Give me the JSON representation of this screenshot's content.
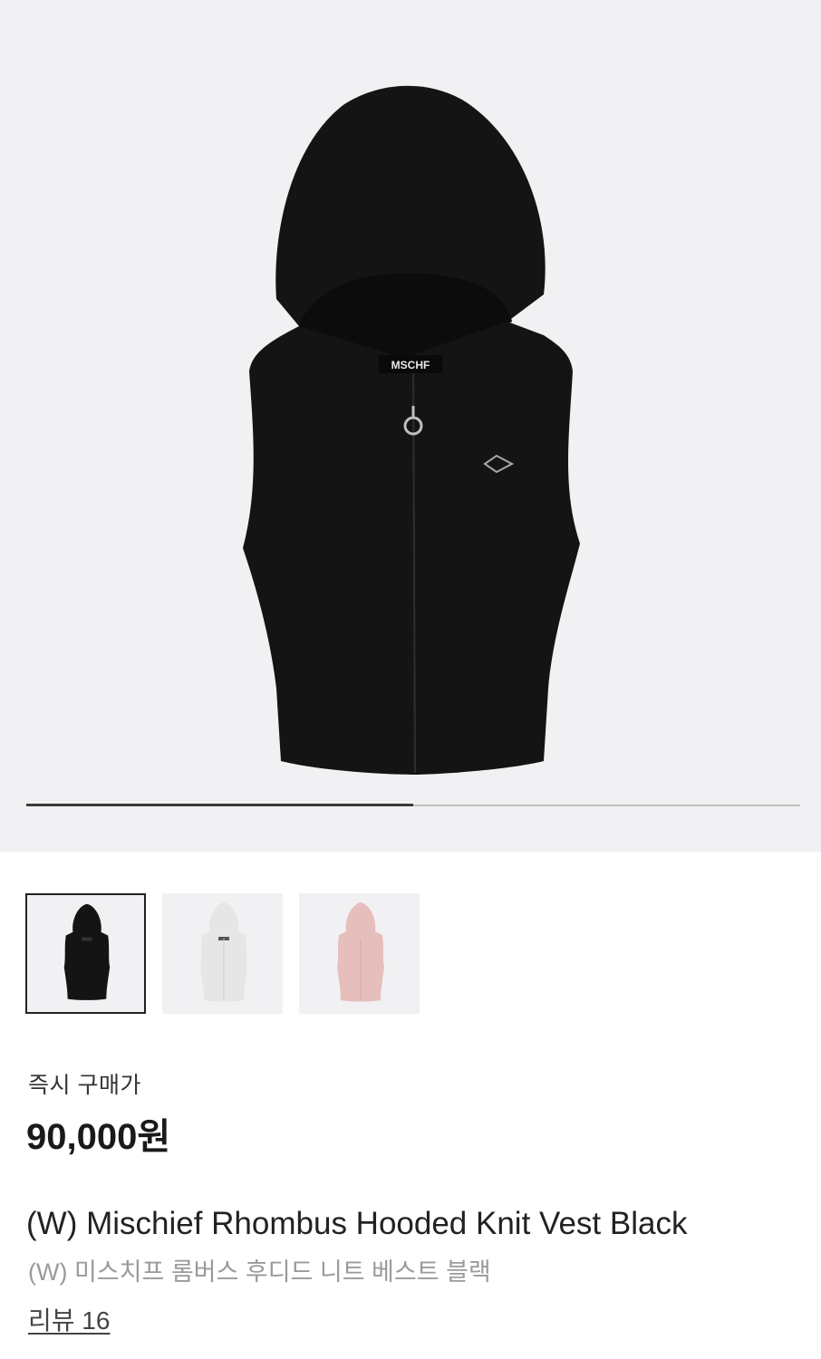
{
  "product_images": {
    "count": 3,
    "current_index": 1,
    "hero_label": "MSCHF"
  },
  "colors": {
    "hero_bg": "#f1f1f3",
    "vest_black": "#141414",
    "vest_white": "#e6e6e6",
    "vest_pink": "#e6bfbc"
  },
  "thumbnails": [
    {
      "name": "black",
      "selected": true
    },
    {
      "name": "white",
      "selected": false
    },
    {
      "name": "pink",
      "selected": false
    }
  ],
  "price_section": {
    "label": "즉시 구매가",
    "price": "90,000원"
  },
  "product": {
    "title_en": "(W) Mischief Rhombus Hooded Knit Vest Black",
    "title_ko": "(W) 미스치프 롬버스 후디드 니트 베스트 블랙",
    "review_link": "리뷰 16"
  }
}
